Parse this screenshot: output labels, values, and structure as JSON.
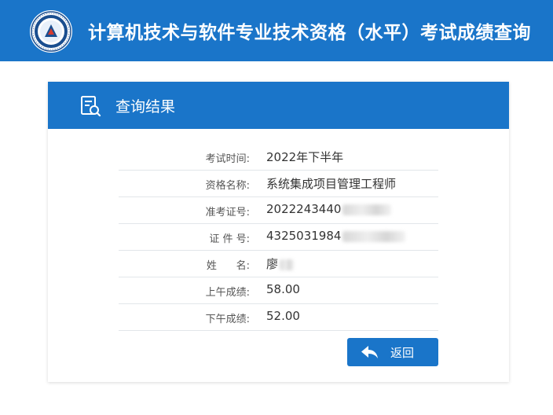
{
  "header": {
    "title": "计算机技术与软件专业技术资格（水平）考试成绩查询",
    "logo": {
      "name": "ruankao-logo",
      "text": "Computer Qualification Institution"
    },
    "background_color": "#1a75c9"
  },
  "result_card": {
    "title": "查询结果",
    "icon": "document-search-icon",
    "rows": [
      {
        "label": "考试时间:",
        "value": "2022年下半年"
      },
      {
        "label": "资格名称:",
        "value": "系统集成项目管理工程师"
      },
      {
        "label": "准考证号:",
        "value": "2022243440",
        "redacted": true
      },
      {
        "label": "证 件 号:",
        "value": "4325031984",
        "redacted": true
      },
      {
        "label": "姓      名:",
        "value": "廖",
        "redacted": true
      },
      {
        "label": "上午成绩:",
        "value": "58.00"
      },
      {
        "label": "下午成绩:",
        "value": "52.00"
      }
    ],
    "back_button": {
      "label": "返回",
      "icon": "reply-arrow-icon"
    }
  }
}
